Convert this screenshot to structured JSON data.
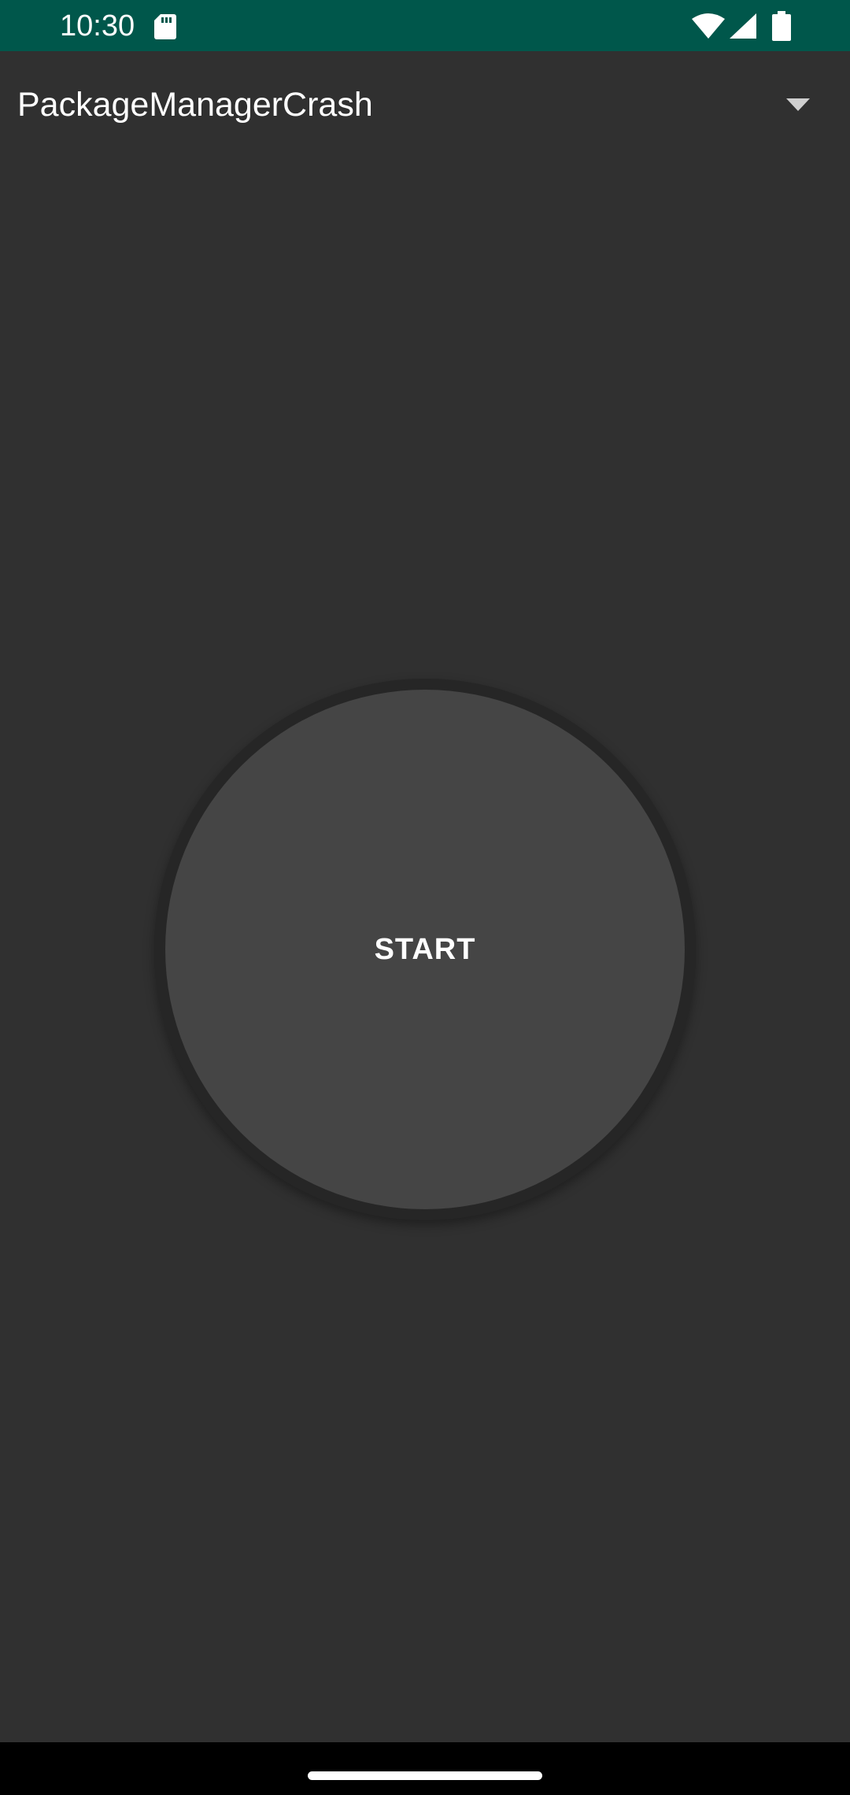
{
  "status_bar": {
    "time": "10:30",
    "background_color": "#00574B",
    "icons": [
      "sd-card-icon",
      "wifi-icon",
      "cell-signal-icon",
      "battery-icon"
    ]
  },
  "toolbar": {
    "spinner_selected": "PackageManagerCrash",
    "dropdown_icon": "dropdown-arrow-icon"
  },
  "main": {
    "start_label": "START",
    "background_color": "#303030",
    "button_color": "#454545"
  },
  "nav_bar": {
    "handle": "home-gesture-handle"
  }
}
